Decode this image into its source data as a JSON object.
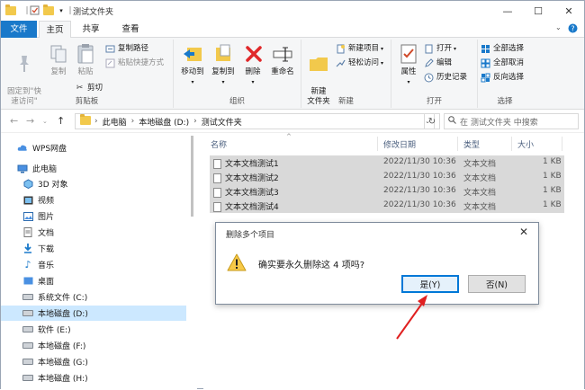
{
  "window": {
    "title": "测试文件夹",
    "controls": {
      "minimize": "—",
      "maximize": "☐",
      "close": "✕"
    }
  },
  "ribbon_tabs": [
    "文件",
    "主页",
    "共享",
    "查看"
  ],
  "ribbon": {
    "clipboard": {
      "label": "剪贴板",
      "pin": "固定到\"快\n速访问\"",
      "copy": "复制",
      "paste": "粘贴",
      "copy_path": "复制路径",
      "paste_shortcut": "粘贴快捷方式",
      "cut": "剪切"
    },
    "organize": {
      "label": "组织",
      "move_to": "移动到",
      "copy_to": "复制到",
      "delete": "删除",
      "rename": "重命名"
    },
    "new": {
      "label": "新建",
      "new_folder": "新建\n文件夹",
      "new_item": "新建项目",
      "easy_access": "轻松访问"
    },
    "open": {
      "label": "打开",
      "properties": "属性",
      "open": "打开",
      "edit": "编辑",
      "history": "历史记录"
    },
    "select": {
      "label": "选择",
      "select_all": "全部选择",
      "select_none": "全部取消",
      "invert": "反向选择"
    }
  },
  "address": {
    "path": [
      "此电脑",
      "本地磁盘 (D:)",
      "测试文件夹"
    ],
    "search_placeholder": "在 测试文件夹 中搜索"
  },
  "nav_pane": [
    {
      "label": "WPS网盘",
      "icon": "cloud-icon",
      "selected": false
    },
    {
      "label": "此电脑",
      "icon": "computer-icon",
      "selected": false
    },
    {
      "label": "3D 对象",
      "icon": "3d-icon",
      "selected": false
    },
    {
      "label": "视频",
      "icon": "video-icon",
      "selected": false
    },
    {
      "label": "图片",
      "icon": "picture-icon",
      "selected": false
    },
    {
      "label": "文档",
      "icon": "document-icon",
      "selected": false
    },
    {
      "label": "下载",
      "icon": "download-icon",
      "selected": false
    },
    {
      "label": "音乐",
      "icon": "music-icon",
      "selected": false
    },
    {
      "label": "桌面",
      "icon": "desktop-icon",
      "selected": false
    },
    {
      "label": "系统文件 (C:)",
      "icon": "drive-icon",
      "selected": false
    },
    {
      "label": "本地磁盘 (D:)",
      "icon": "drive-icon",
      "selected": true
    },
    {
      "label": "软件 (E:)",
      "icon": "drive-icon",
      "selected": false
    },
    {
      "label": "本地磁盘 (F:)",
      "icon": "drive-icon",
      "selected": false
    },
    {
      "label": "本地磁盘 (G:)",
      "icon": "drive-icon",
      "selected": false
    },
    {
      "label": "本地磁盘 (H:)",
      "icon": "drive-icon",
      "selected": false
    }
  ],
  "columns": {
    "name": "名称",
    "date": "修改日期",
    "type": "类型",
    "size": "大小"
  },
  "files": [
    {
      "name": "文本文档测试1",
      "date": "2022/11/30 10:36",
      "type": "文本文档",
      "size": "1 KB"
    },
    {
      "name": "文本文档测试2",
      "date": "2022/11/30 10:36",
      "type": "文本文档",
      "size": "1 KB"
    },
    {
      "name": "文本文档测试3",
      "date": "2022/11/30 10:36",
      "type": "文本文档",
      "size": "1 KB"
    },
    {
      "name": "文本文档测试4",
      "date": "2022/11/30 10:36",
      "type": "文本文档",
      "size": "1 KB"
    }
  ],
  "dialog": {
    "title": "删除多个项目",
    "message": "确实要永久删除这 4 项吗?",
    "yes": "是(Y)",
    "no": "否(N)",
    "close": "✕"
  },
  "colors": {
    "accent": "#0078d7",
    "file_tab": "#1979ca",
    "annotation_arrow": "#e02020",
    "selection": "#cce8ff"
  }
}
